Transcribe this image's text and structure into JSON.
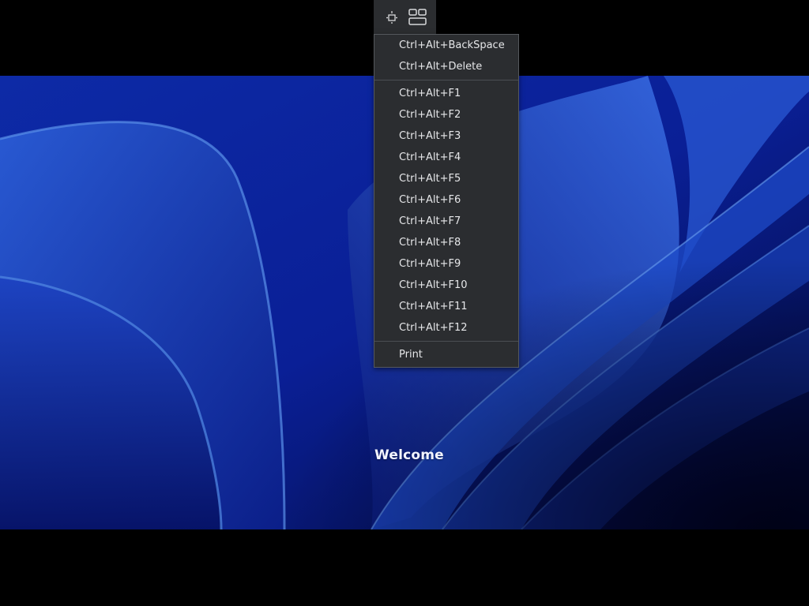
{
  "toolbar": {
    "buttons": [
      {
        "name": "move-toolbar-icon"
      },
      {
        "name": "display-layout-icon"
      }
    ]
  },
  "menu": {
    "groups": [
      [
        "Ctrl+Alt+BackSpace",
        "Ctrl+Alt+Delete"
      ],
      [
        "Ctrl+Alt+F1",
        "Ctrl+Alt+F2",
        "Ctrl+Alt+F3",
        "Ctrl+Alt+F4",
        "Ctrl+Alt+F5",
        "Ctrl+Alt+F6",
        "Ctrl+Alt+F7",
        "Ctrl+Alt+F8",
        "Ctrl+Alt+F9",
        "Ctrl+Alt+F10",
        "Ctrl+Alt+F11",
        "Ctrl+Alt+F12"
      ],
      [
        "Print"
      ]
    ]
  },
  "desktop": {
    "welcome": "Welcome"
  },
  "colors": {
    "toolbar_bg": "#2b2d30",
    "menu_text": "#e6e7e9",
    "wallpaper_base": "#0a1c8c"
  }
}
